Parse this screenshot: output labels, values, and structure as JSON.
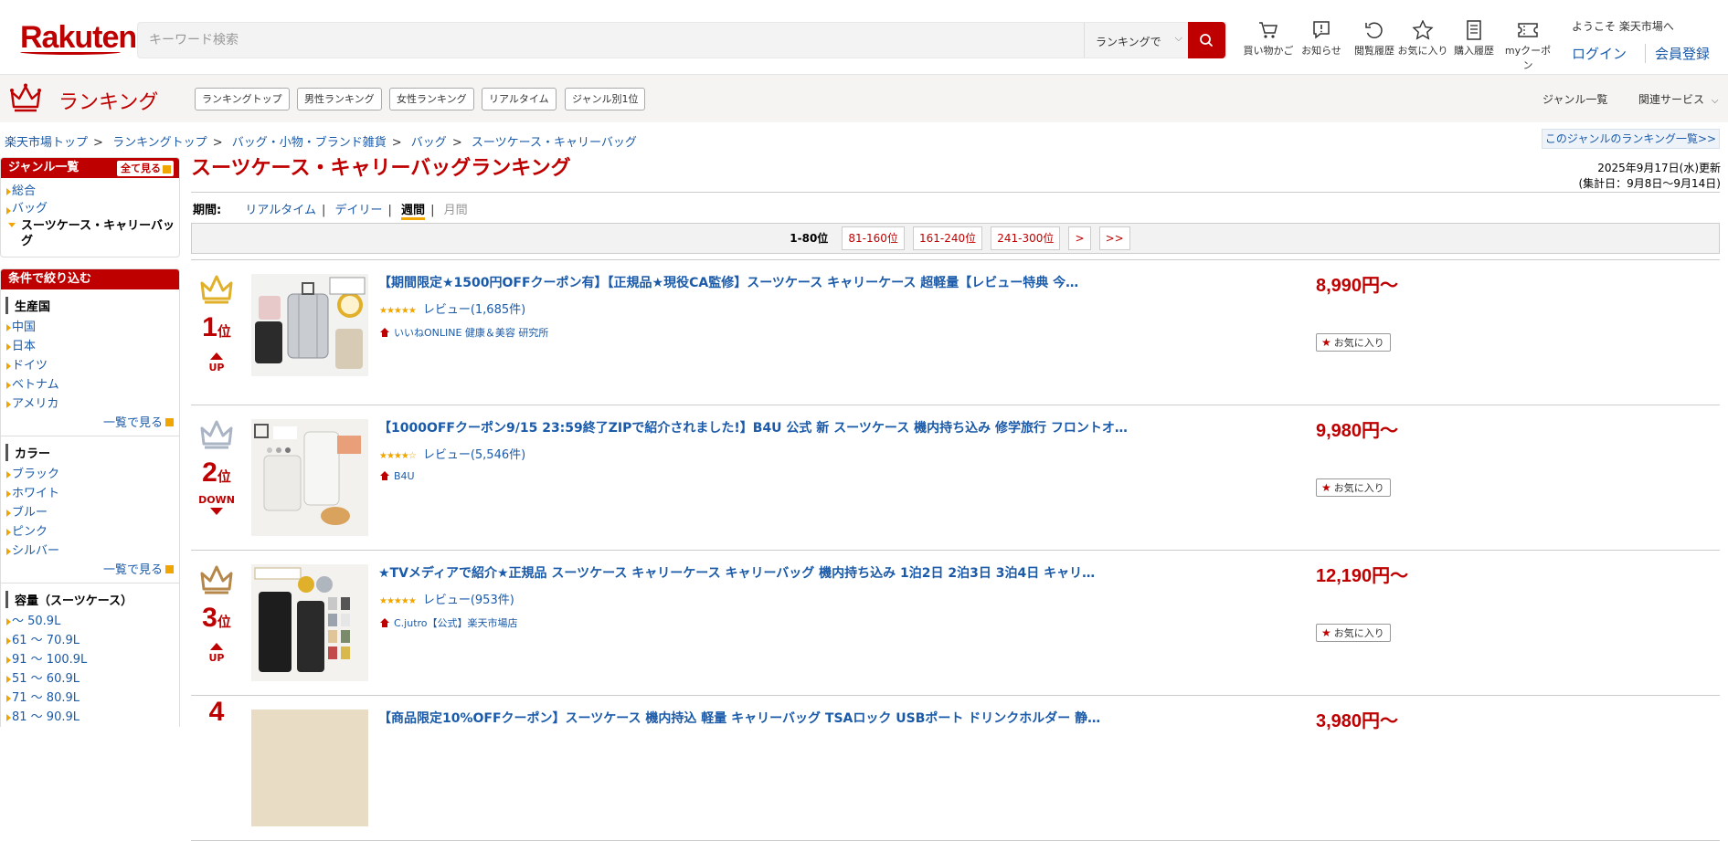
{
  "header": {
    "logo": "Rakuten",
    "search_placeholder": "キーワード検索",
    "search_scope": "ランキングで",
    "icons": [
      {
        "icon": "cart-icon",
        "label": "買い物かご"
      },
      {
        "icon": "notification-icon",
        "label": "お知らせ"
      },
      {
        "icon": "history-icon",
        "label": "閲覧履歴"
      },
      {
        "icon": "star-icon",
        "label": "お気に入り"
      },
      {
        "icon": "receipt-icon",
        "label": "購入履歴"
      },
      {
        "icon": "coupon-icon",
        "label": "myクーポン"
      }
    ],
    "welcome": "ようこそ 楽天市場へ",
    "login": "ログイン",
    "register": "会員登録"
  },
  "rankbar": {
    "title": "ランキング",
    "tabs": [
      "ランキングトップ",
      "男性ランキング",
      "女性ランキング",
      "リアルタイム",
      "ジャンル別1位"
    ],
    "genre_list": "ジャンル一覧",
    "related": "関連サービス"
  },
  "breadcrumb": [
    "楽天市場トップ",
    "ランキングトップ",
    "バッグ・小物・ブランド雑貨",
    "バッグ",
    "スーツケース・キャリーバッグ"
  ],
  "genre_ranking_link": "このジャンルのランキング一覧>>",
  "sidebar": {
    "genre_title": "ジャンル一覧",
    "show_all": "全て見る",
    "genres": [
      "総合",
      "バッグ",
      "スーツケース・キャリーバッグ"
    ],
    "filter_title": "条件で絞り込む",
    "groups": [
      {
        "title": "生産国",
        "items": [
          "中国",
          "日本",
          "ドイツ",
          "ベトナム",
          "アメリカ"
        ],
        "more": "一覧で見る"
      },
      {
        "title": "カラー",
        "items": [
          "ブラック",
          "ホワイト",
          "ブルー",
          "ピンク",
          "シルバー"
        ],
        "more": "一覧で見る"
      },
      {
        "title": "容量（スーツケース）",
        "items": [
          "〜 50.9L",
          "61 〜 70.9L",
          "91 〜 100.9L",
          "51 〜 60.9L",
          "71 〜 80.9L",
          "81 〜 90.9L"
        ]
      }
    ]
  },
  "main": {
    "title": "スーツケース・キャリーバッグランキング",
    "updated": "2025年9月17日(水)更新",
    "period_note": "(集計日：9月8日〜9月14日)",
    "period_label": "期間:",
    "periods": [
      "リアルタイム",
      "デイリー",
      "週間",
      "月間"
    ],
    "pager": {
      "current": "1-80位",
      "pages": [
        "81-160位",
        "161-240位",
        "241-300位",
        ">",
        ">>"
      ]
    }
  },
  "items": [
    {
      "rank": "1",
      "rank_suffix": "位",
      "movement": "UP",
      "title": "【期間限定★1500円OFFクーポン有】【正規品★現役CA監修】スーツケース キャリーケース 超軽量【レビュー特典 今…",
      "review": "レビュー(1,685件)",
      "shop": "いいねONLINE 健康＆美容 研究所",
      "price": "8,990円〜",
      "fav": "お気に入り",
      "crown_color": "#e0b02a"
    },
    {
      "rank": "2",
      "rank_suffix": "位",
      "movement": "DOWN",
      "title": "【1000OFFクーポン9/15 23:59終了ZIPで紹介されました!】B4U 公式 新 スーツケース 機内持ち込み 修学旅行 フロントオ…",
      "review": "レビュー(5,546件)",
      "shop": "B4U",
      "price": "9,980円〜",
      "fav": "お気に入り",
      "crown_color": "#aab4c4"
    },
    {
      "rank": "3",
      "rank_suffix": "位",
      "movement": "UP",
      "title": "★TVメディアで紹介★正規品 スーツケース キャリーケース キャリーバッグ 機内持ち込み 1泊2日 2泊3日 3泊4日 キャリ…",
      "review": "レビュー(953件)",
      "shop": "C.jutro【公式】楽天市場店",
      "price": "12,190円〜",
      "fav": "お気に入り",
      "crown_color": "#b5874a"
    },
    {
      "rank": "4",
      "rank_suffix": "",
      "movement": "",
      "title": "【商品限定10%OFFクーポン】スーツケース 機内持込 軽量 キャリーバッグ TSAロック USBポート ドリンクホルダー 静…",
      "review": "",
      "shop": "",
      "price": "3,980円〜",
      "fav": "",
      "crown_color": "#bf0000"
    }
  ],
  "colors": {
    "brand": "#bf0000",
    "link": "#1a5aa8",
    "accent": "#f0a500"
  }
}
